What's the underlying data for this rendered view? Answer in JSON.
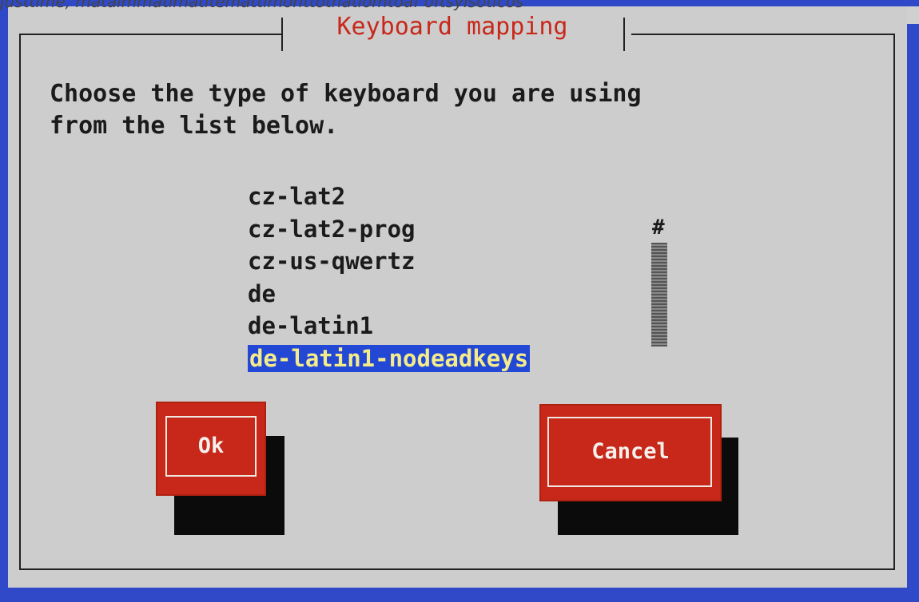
{
  "header": {
    "cropped_text": "justtime, mataimmatimatitemattimonttothatiomtoaf oftsyisoticos"
  },
  "dialog": {
    "title": "Keyboard mapping",
    "prompt_line1": "Choose the type of keyboard you are using",
    "prompt_line2": "from the list below.",
    "keymaps": [
      {
        "label": "cz-lat2",
        "selected": false
      },
      {
        "label": "cz-lat2-prog",
        "selected": false
      },
      {
        "label": "cz-us-qwertz",
        "selected": false
      },
      {
        "label": "de",
        "selected": false
      },
      {
        "label": "de-latin1",
        "selected": false
      },
      {
        "label": "de-latin1-nodeadkeys",
        "selected": true
      }
    ],
    "scroll_marker": "#",
    "buttons": {
      "ok": "Ok",
      "cancel": "Cancel"
    }
  },
  "colors": {
    "dialog_bg": "#cdcdcd",
    "title": "#c8281a",
    "button_bg": "#c8281a",
    "selection_bg": "#2348d6",
    "selection_fg": "#f4ec8a",
    "screen_border": "#2f49c8"
  }
}
